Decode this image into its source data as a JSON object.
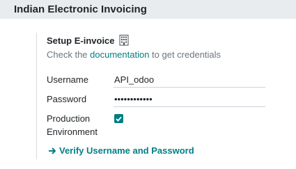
{
  "section": {
    "title": "Indian Electronic Invoicing"
  },
  "setting": {
    "title": "Setup E-invoice",
    "title_icon": "building-icon",
    "desc_prefix": "Check the ",
    "desc_link": "documentation",
    "desc_suffix": " to get credentials"
  },
  "fields": {
    "username_label": "Username",
    "username_value": "API_odoo",
    "password_label": "Password",
    "password_value": "••••••••••••",
    "production_label_line1": "Production",
    "production_label_line2": "Environment",
    "production_checked": true
  },
  "actions": {
    "verify_label": "Verify Username and Password",
    "verify_icon": "arrow-right-icon"
  },
  "colors": {
    "accent": "#017e84",
    "header_bg": "#e9ecef",
    "muted_text": "#6c757d"
  }
}
